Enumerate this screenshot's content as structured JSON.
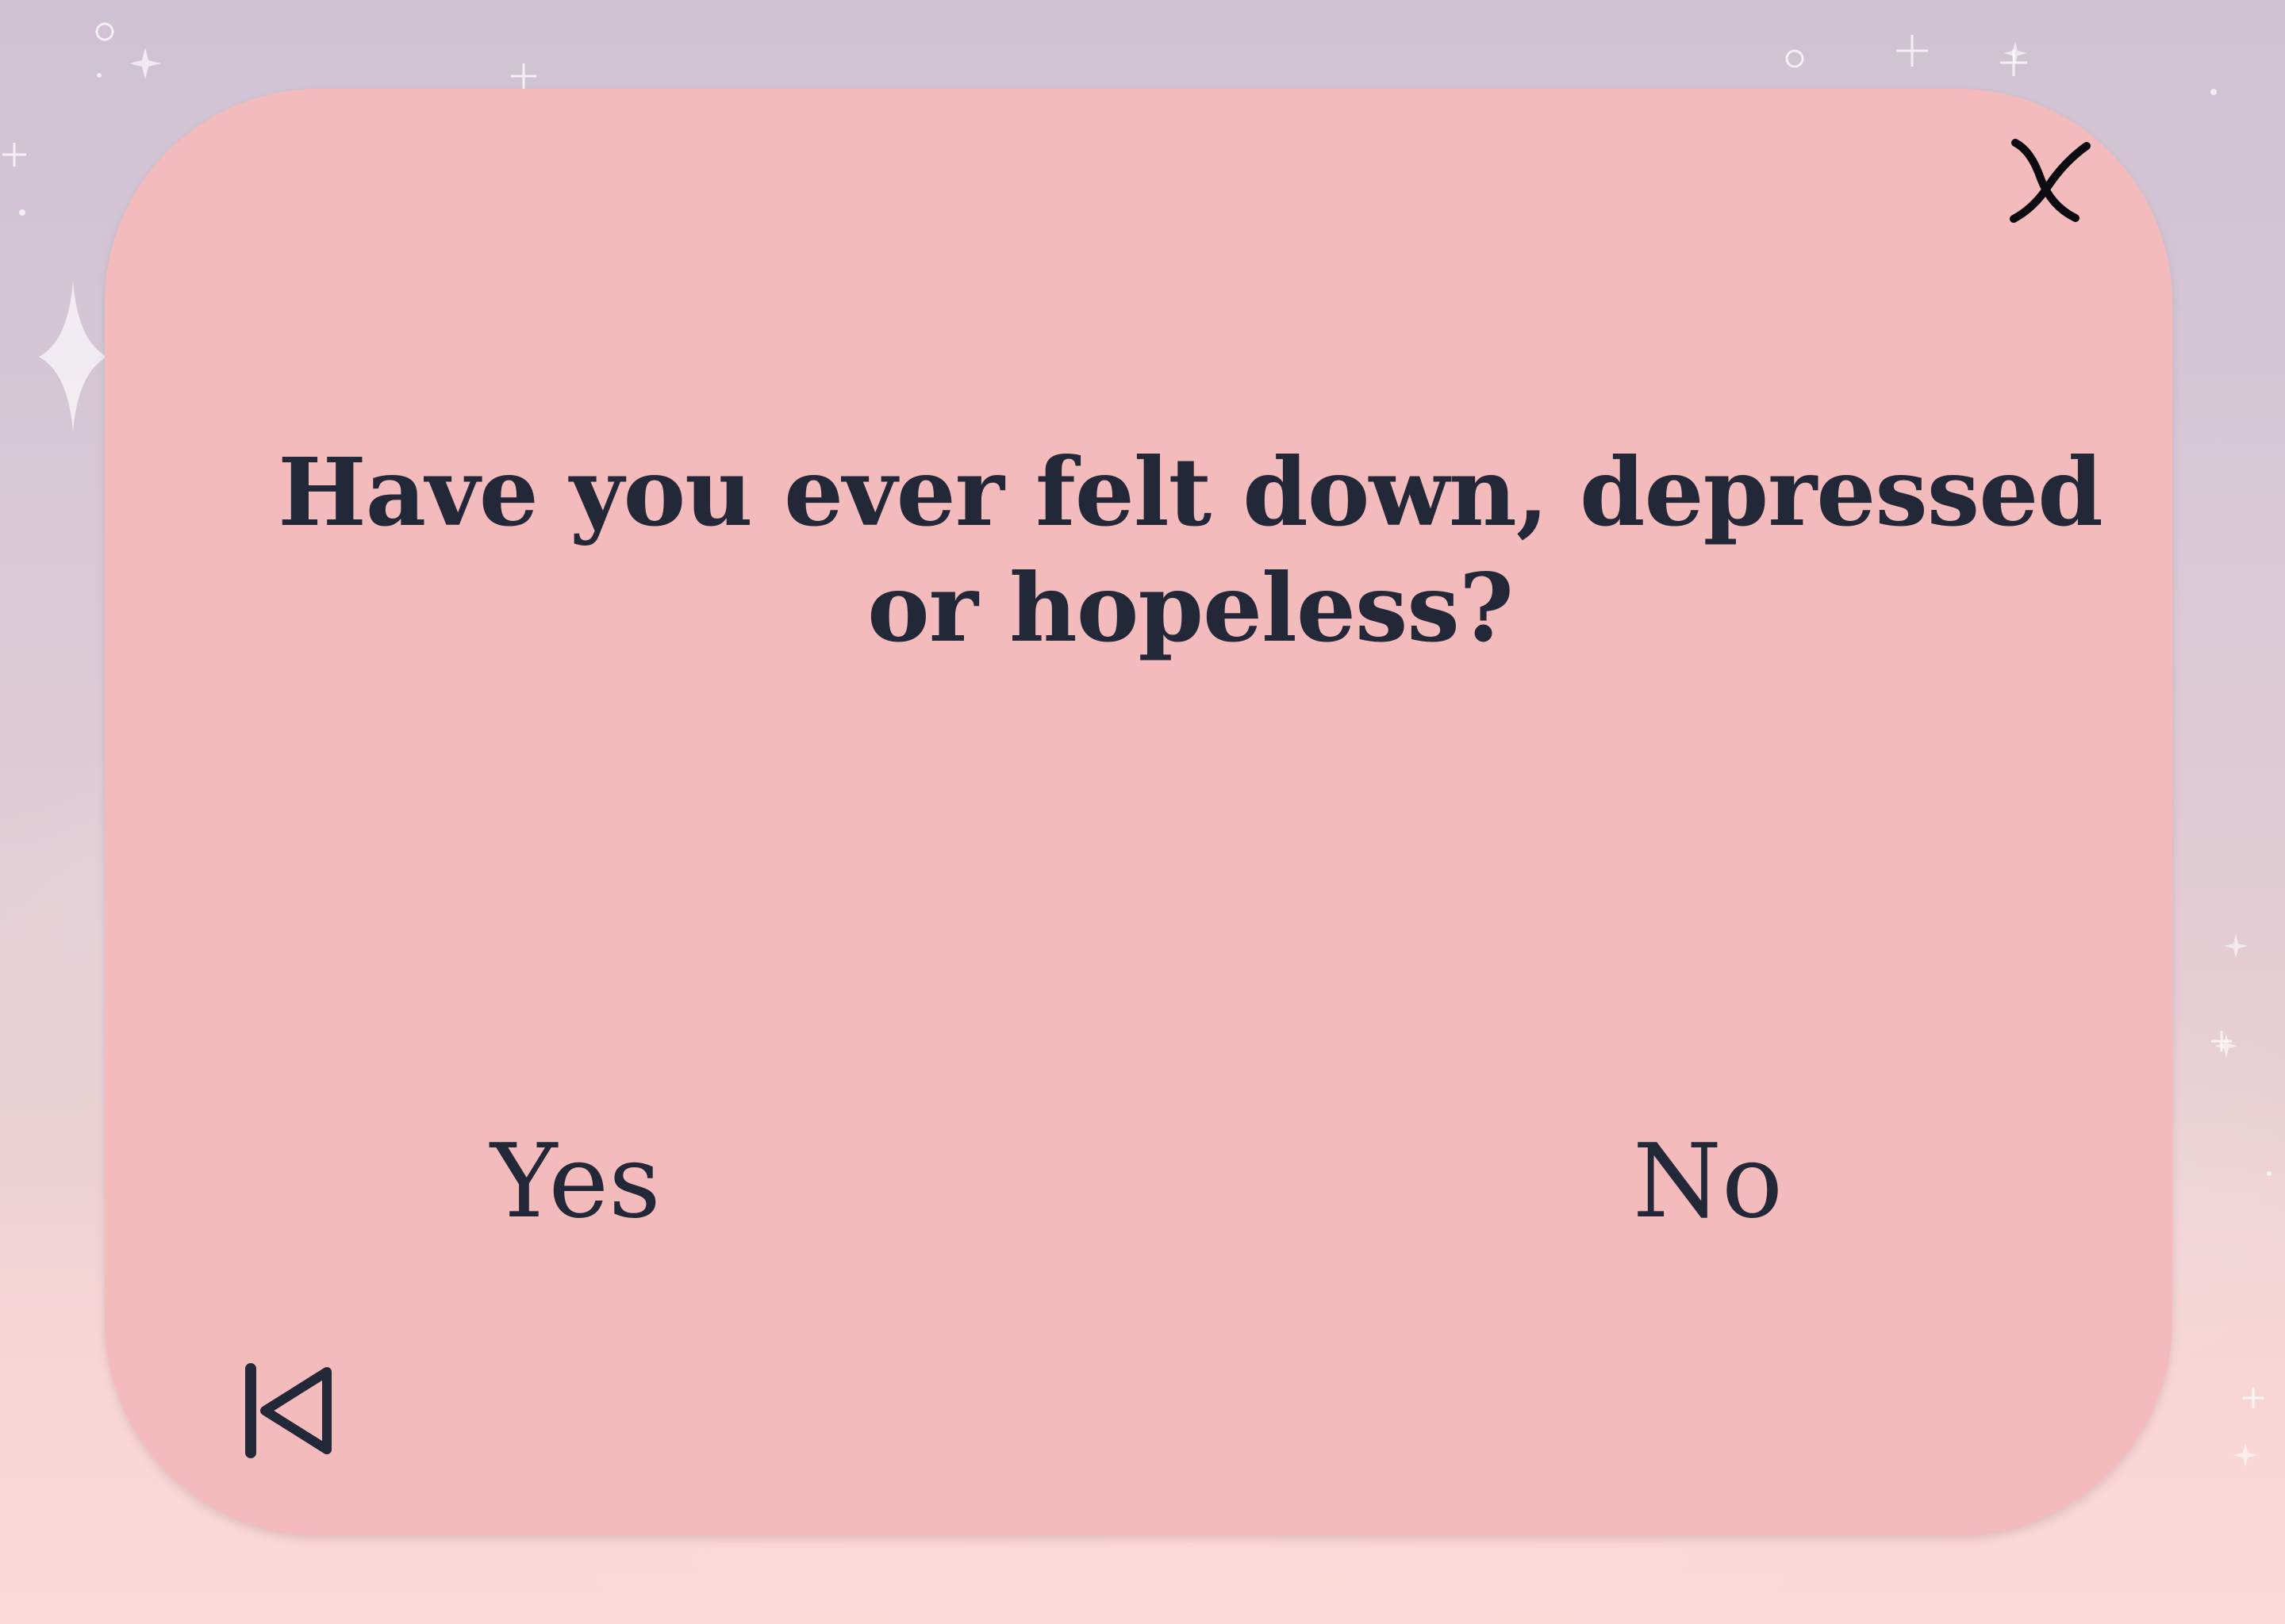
{
  "dialog": {
    "question": "Have you ever felt down, depressed or hopeless?",
    "answers": [
      {
        "label": "Yes"
      },
      {
        "label": "No"
      }
    ],
    "close_icon": "close-x-icon",
    "back_icon": "skip-back-icon"
  },
  "colors": {
    "card_background": "#f4bbbd",
    "text": "#232838",
    "background_top": "#cfc2d2",
    "background_bottom": "#fbd9d8"
  }
}
